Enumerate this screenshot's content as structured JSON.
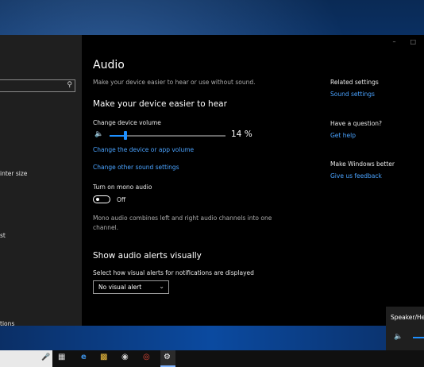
{
  "sidebar": {
    "items": [
      {
        "label": "inter size"
      },
      {
        "label": "st"
      },
      {
        "label": "tions"
      }
    ]
  },
  "main": {
    "title": "Audio",
    "subtitle": "Make your device easier to hear or use without sound.",
    "section1_heading": "Make your device easier to hear",
    "volume_label": "Change device volume",
    "volume_percent": 14,
    "volume_value_text": "14 %",
    "link_app_volume": "Change the device or app volume",
    "link_other_sound": "Change other sound settings",
    "mono_label": "Turn on mono audio",
    "mono_state": "Off",
    "mono_description": "Mono audio combines left and right audio channels into one channel.",
    "section2_heading": "Show audio alerts visually",
    "alerts_label": "Select how visual alerts for notifications are displayed",
    "alerts_value": "No visual alert"
  },
  "right": {
    "related_heading": "Related settings",
    "related_link": "Sound settings",
    "question_heading": "Have a question?",
    "help_link": "Get help",
    "improve_heading": "Make Windows better",
    "feedback_link": "Give us feedback"
  },
  "flyout": {
    "title": "Speaker/Hea"
  },
  "icons": {
    "volume": "speaker-icon",
    "search": "search-icon",
    "mic": "microphone-icon",
    "task_view": "task-view-icon",
    "edge": "edge-icon",
    "explorer": "folder-icon",
    "store": "store-icon",
    "chrome": "chrome-icon",
    "settings": "gear-icon"
  },
  "colors": {
    "accent": "#1e90ff",
    "link": "#4aa3ff",
    "window_bg": "#000000",
    "sidebar_bg": "#1f1f1f"
  }
}
